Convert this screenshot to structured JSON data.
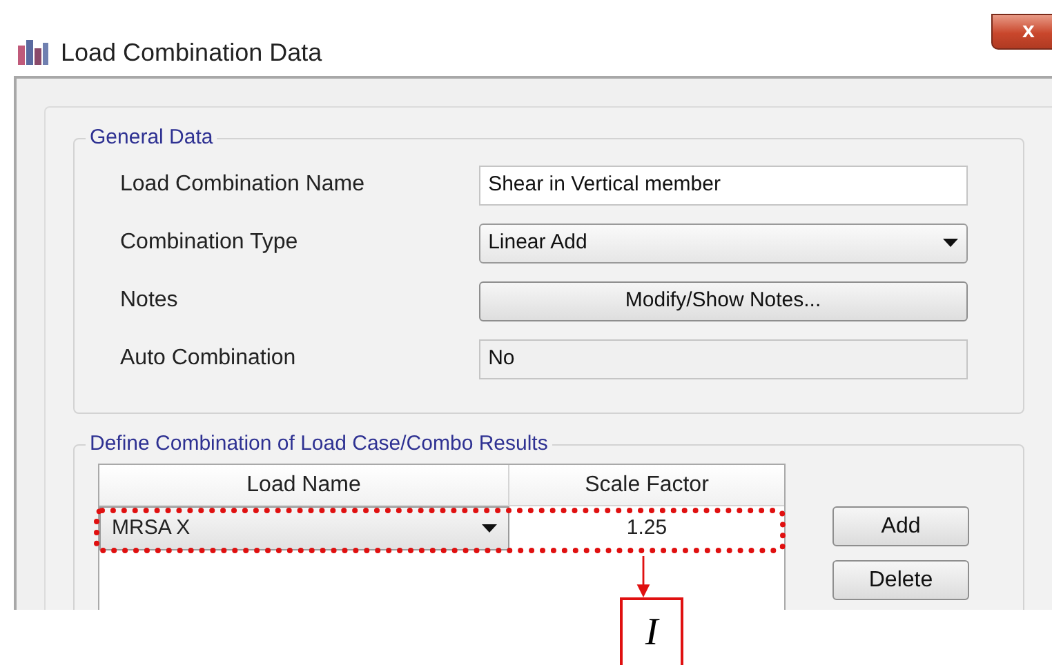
{
  "window": {
    "title": "Load Combination Data",
    "close": "x"
  },
  "general_data": {
    "title": "General Data",
    "fields": [
      {
        "label": "Load Combination Name",
        "kind": "text",
        "value": "Shear in Vertical member"
      },
      {
        "label": "Combination Type",
        "kind": "dropdown",
        "value": "Linear Add"
      },
      {
        "label": "Notes",
        "kind": "button",
        "value": "Modify/Show Notes..."
      },
      {
        "label": "Auto Combination",
        "kind": "readonly",
        "value": "No"
      }
    ]
  },
  "combination": {
    "title": "Define Combination of Load Case/Combo Results",
    "columns": [
      "Load Name",
      "Scale Factor"
    ],
    "rows": [
      {
        "load_name": "MRSA X",
        "scale_factor": "1.25",
        "highlighted": true
      }
    ],
    "buttons": [
      "Add",
      "Delete"
    ]
  },
  "annotation": {
    "label": "I"
  }
}
